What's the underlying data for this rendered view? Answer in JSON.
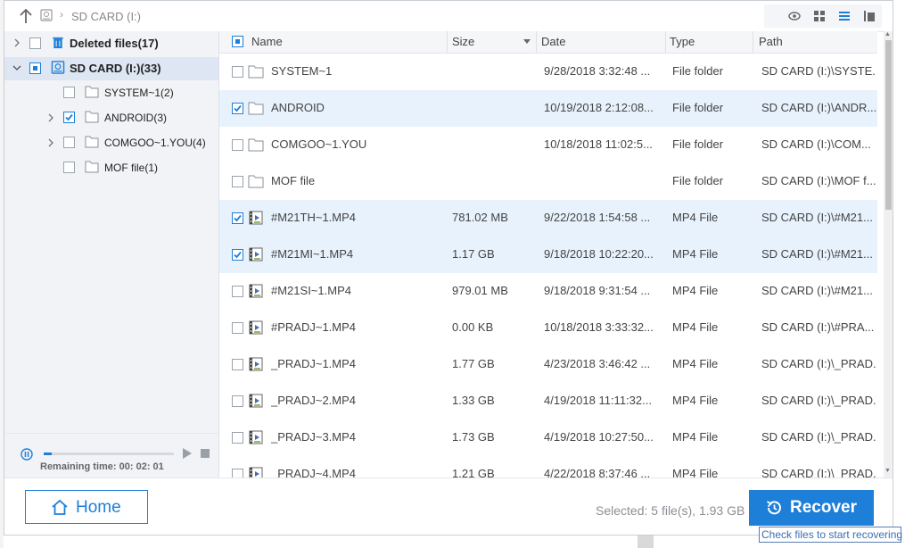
{
  "address": {
    "drive": "SD CARD (I:)"
  },
  "tree": {
    "nodes": [
      {
        "label": "Deleted files(17)",
        "state": "none"
      },
      {
        "label": "SD CARD (I:)(33)",
        "state": "partial"
      },
      {
        "label": "SYSTEM~1(2)",
        "state": "none"
      },
      {
        "label": "ANDROID(3)",
        "state": "checked"
      },
      {
        "label": "COMGOO~1.YOU(4)",
        "state": "none"
      },
      {
        "label": "MOF file(1)",
        "state": "none"
      }
    ]
  },
  "progress": {
    "remaining": "Remaining time: 00: 02: 01",
    "fraction": 0.06
  },
  "columns": {
    "name": "Name",
    "size": "Size",
    "date": "Date",
    "type": "Type",
    "path": "Path"
  },
  "rows": [
    {
      "name": "SYSTEM~1",
      "size": "",
      "date": "9/28/2018 3:32:48 ...",
      "type": "File folder",
      "path": "SD CARD (I:)\\SYSTE...",
      "checked": false,
      "icon": "folder-icon"
    },
    {
      "name": "ANDROID",
      "size": "",
      "date": "10/19/2018 2:12:08...",
      "type": "File folder",
      "path": "SD CARD (I:)\\ANDR...",
      "checked": true,
      "icon": "folder-icon"
    },
    {
      "name": "COMGOO~1.YOU",
      "size": "",
      "date": "10/18/2018 11:02:5...",
      "type": "File folder",
      "path": "SD CARD (I:)\\COM...",
      "checked": false,
      "icon": "folder-icon"
    },
    {
      "name": "MOF file",
      "size": "",
      "date": "",
      "type": "File folder",
      "path": "SD CARD (I:)\\MOF f...",
      "checked": false,
      "icon": "folder-icon"
    },
    {
      "name": "#M21TH~1.MP4",
      "size": "781.02 MB",
      "date": "9/22/2018 1:54:58 ...",
      "type": "MP4 File",
      "path": "SD CARD (I:)\\#M21...",
      "checked": true,
      "icon": "video-file-icon"
    },
    {
      "name": "#M21MI~1.MP4",
      "size": "1.17 GB",
      "date": "9/18/2018 10:22:20...",
      "type": "MP4 File",
      "path": "SD CARD (I:)\\#M21...",
      "checked": true,
      "icon": "video-file-icon"
    },
    {
      "name": "#M21SI~1.MP4",
      "size": "979.01 MB",
      "date": "9/18/2018 9:31:54 ...",
      "type": "MP4 File",
      "path": "SD CARD (I:)\\#M21...",
      "checked": false,
      "icon": "video-file-icon"
    },
    {
      "name": "#PRADJ~1.MP4",
      "size": "0.00 KB",
      "date": "10/18/2018 3:33:32...",
      "type": "MP4 File",
      "path": "SD CARD (I:)\\#PRA...",
      "checked": false,
      "icon": "video-file-icon"
    },
    {
      "name": "_PRADJ~1.MP4",
      "size": "1.77 GB",
      "date": "4/23/2018 3:46:42 ...",
      "type": "MP4 File",
      "path": "SD CARD (I:)\\_PRAD...",
      "checked": false,
      "icon": "video-file-icon"
    },
    {
      "name": "_PRADJ~2.MP4",
      "size": "1.33 GB",
      "date": "4/19/2018 11:11:32...",
      "type": "MP4 File",
      "path": "SD CARD (I:)\\_PRAD...",
      "checked": false,
      "icon": "video-file-icon"
    },
    {
      "name": "_PRADJ~3.MP4",
      "size": "1.73 GB",
      "date": "4/19/2018 10:27:50...",
      "type": "MP4 File",
      "path": "SD CARD (I:)\\_PRAD...",
      "checked": false,
      "icon": "video-file-icon"
    },
    {
      "name": "_PRADJ~4.MP4",
      "size": "1.21 GB",
      "date": "4/22/2018 8:37:46 ...",
      "type": "MP4 File",
      "path": "SD CARD (I:)\\_PRAD...",
      "checked": false,
      "icon": "video-file-icon"
    }
  ],
  "footer": {
    "home": "Home",
    "selected": "Selected: 5 file(s), 1.93 GB",
    "recover": "Recover",
    "tooltip": "Check files to start recovering"
  },
  "colors": {
    "accent": "#1e7fd8",
    "checked_row": "#e8f2fc",
    "tree_bg": "#f1f3f6"
  }
}
